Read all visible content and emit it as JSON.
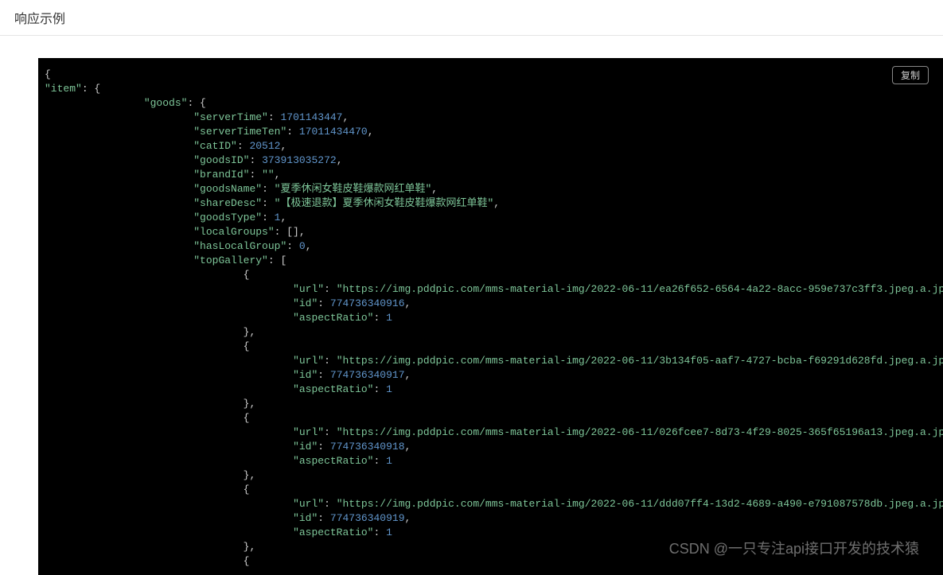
{
  "header": {
    "title": "响应示例"
  },
  "copy_button": {
    "label": "复制"
  },
  "watermark": {
    "text": "CSDN @一只专注api接口开发的技术猿"
  },
  "code": {
    "root": {
      "open": "{",
      "item_key": "\"item\"",
      "item_open": ": {",
      "goods_key": "\"goods\"",
      "goods_open": ": {",
      "fields": {
        "serverTime": {
          "key": "\"serverTime\"",
          "value": "1701143447"
        },
        "serverTimeTen": {
          "key": "\"serverTimeTen\"",
          "value": "17011434470"
        },
        "catID": {
          "key": "\"catID\"",
          "value": "20512"
        },
        "goodsID": {
          "key": "\"goodsID\"",
          "value": "373913035272"
        },
        "brandId": {
          "key": "\"brandId\"",
          "value": "\"\""
        },
        "goodsName": {
          "key": "\"goodsName\"",
          "value": "\"夏季休闲女鞋皮鞋爆款网红单鞋\""
        },
        "shareDesc": {
          "key": "\"shareDesc\"",
          "value": "\"【极速退款】夏季休闲女鞋皮鞋爆款网红单鞋\""
        },
        "goodsType": {
          "key": "\"goodsType\"",
          "value": "1"
        },
        "localGroups": {
          "key": "\"localGroups\"",
          "value": "[]"
        },
        "hasLocalGroup": {
          "key": "\"hasLocalGroup\"",
          "value": "0"
        },
        "topGallery_key": "\"topGallery\"",
        "topGallery_open": ": [",
        "gallery": [
          {
            "url_key": "\"url\"",
            "url_value": "\"https://img.pddpic.com/mms-material-img/2022-06-11/ea26f652-6564-4a22-8acc-959e737c3ff3.jpeg.a.jpeg\"",
            "id_key": "\"id\"",
            "id_value": "774736340916",
            "aspectRatio_key": "\"aspectRatio\"",
            "aspectRatio_value": "1"
          },
          {
            "url_key": "\"url\"",
            "url_value": "\"https://img.pddpic.com/mms-material-img/2022-06-11/3b134f05-aaf7-4727-bcba-f69291d628fd.jpeg.a.jpeg\"",
            "id_key": "\"id\"",
            "id_value": "774736340917",
            "aspectRatio_key": "\"aspectRatio\"",
            "aspectRatio_value": "1"
          },
          {
            "url_key": "\"url\"",
            "url_value": "\"https://img.pddpic.com/mms-material-img/2022-06-11/026fcee7-8d73-4f29-8025-365f65196a13.jpeg.a.jpeg\"",
            "id_key": "\"id\"",
            "id_value": "774736340918",
            "aspectRatio_key": "\"aspectRatio\"",
            "aspectRatio_value": "1"
          },
          {
            "url_key": "\"url\"",
            "url_value": "\"https://img.pddpic.com/mms-material-img/2022-06-11/ddd07ff4-13d2-4689-a490-e791087578db.jpeg.a.jpeg\"",
            "id_key": "\"id\"",
            "id_value": "774736340919",
            "aspectRatio_key": "\"aspectRatio\"",
            "aspectRatio_value": "1"
          }
        ]
      }
    }
  }
}
